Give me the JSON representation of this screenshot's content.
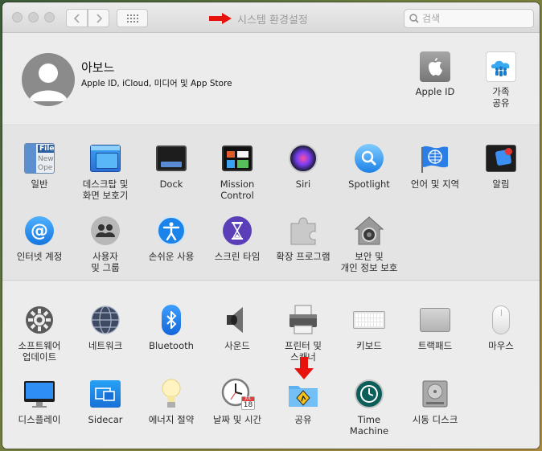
{
  "window": {
    "title": "시스템 환경설정"
  },
  "search": {
    "placeholder": "검색"
  },
  "account": {
    "name": "아보느",
    "subtitle": "Apple ID, iCloud, 미디어 및 App Store",
    "apple_id_label": "Apple ID",
    "family_label_1": "가족",
    "family_label_2": "공유"
  },
  "prefs_row1": [
    {
      "l1": "일반",
      "l2": ""
    },
    {
      "l1": "데스크탑 및",
      "l2": "화면 보호기"
    },
    {
      "l1": "Dock",
      "l2": ""
    },
    {
      "l1": "Mission",
      "l2": "Control"
    },
    {
      "l1": "Siri",
      "l2": ""
    },
    {
      "l1": "Spotlight",
      "l2": ""
    },
    {
      "l1": "언어 및 지역",
      "l2": ""
    },
    {
      "l1": "알림",
      "l2": ""
    }
  ],
  "prefs_row2": [
    {
      "l1": "인터넷 계정",
      "l2": ""
    },
    {
      "l1": "사용자",
      "l2": "및 그룹"
    },
    {
      "l1": "손쉬운 사용",
      "l2": ""
    },
    {
      "l1": "스크린 타임",
      "l2": ""
    },
    {
      "l1": "확장 프로그램",
      "l2": ""
    },
    {
      "l1": "보안 및",
      "l2": "개인 정보 보호"
    }
  ],
  "prefs_row3": [
    {
      "l1": "소프트웨어",
      "l2": "업데이트"
    },
    {
      "l1": "네트워크",
      "l2": ""
    },
    {
      "l1": "Bluetooth",
      "l2": ""
    },
    {
      "l1": "사운드",
      "l2": ""
    },
    {
      "l1": "프린터 및",
      "l2": "스캐너"
    },
    {
      "l1": "키보드",
      "l2": ""
    },
    {
      "l1": "트랙패드",
      "l2": ""
    },
    {
      "l1": "마우스",
      "l2": ""
    }
  ],
  "prefs_row4": [
    {
      "l1": "디스플레이",
      "l2": ""
    },
    {
      "l1": "Sidecar",
      "l2": ""
    },
    {
      "l1": "에너지 절약",
      "l2": ""
    },
    {
      "l1": "날짜 및 시간",
      "l2": ""
    },
    {
      "l1": "공유",
      "l2": ""
    },
    {
      "l1": "Time",
      "l2": "Machine"
    },
    {
      "l1": "시동 디스크",
      "l2": ""
    }
  ],
  "icons": {
    "general_file": "File",
    "general_new": "New",
    "general_ope": "Ope",
    "calendar_month": "JUL",
    "calendar_day": "18"
  },
  "colors": {
    "annotation_arrow": "#e8120c",
    "accent": "#1e7cf2"
  }
}
